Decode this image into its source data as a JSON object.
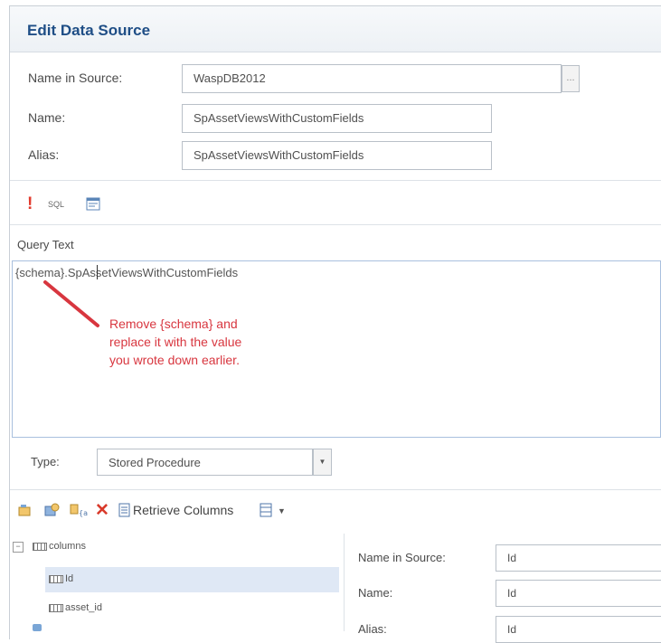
{
  "dialog": {
    "title": "Edit Data Source"
  },
  "form": {
    "name_in_source_label": "Name in Source:",
    "name_in_source_value": "WaspDB2012",
    "ellipsis": "...",
    "name_label": "Name:",
    "name_value": "SpAssetViewsWithCustomFields",
    "alias_label": "Alias:",
    "alias_value": "SpAssetViewsWithCustomFields"
  },
  "query_toolbar": {
    "exclamation": "!",
    "sql": "SQL"
  },
  "query": {
    "label": "Query Text",
    "text": "{schema}.SpAssetViewsWithCustomFields",
    "annotation_lines": [
      "Remove {schema} and",
      "replace it with the value",
      "you wrote down earlier."
    ],
    "annotation_color": "#d8363f"
  },
  "type_row": {
    "label": "Type:",
    "value": "Stored Procedure"
  },
  "columns_toolbar": {
    "retrieve_columns_label": "Retrieve Columns"
  },
  "tree": {
    "root": "columns",
    "items": [
      "Id",
      "asset_id"
    ]
  },
  "column_props": {
    "name_in_source_label": "Name in Source:",
    "name_in_source_value": "Id",
    "name_label": "Name:",
    "name_value": "Id",
    "alias_label": "Alias:",
    "alias_value": "Id"
  }
}
